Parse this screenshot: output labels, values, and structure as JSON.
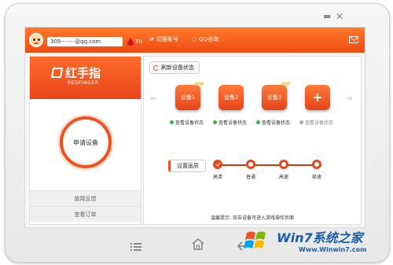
{
  "window": {
    "minimize_icon": "minimize-icon",
    "close_icon": "close-icon"
  },
  "topbar": {
    "account": "309········@qq.com",
    "points": "70",
    "switch_account": "切换账号",
    "qq_support": "QQ咨询"
  },
  "left": {
    "logo_text": "红手指",
    "logo_sub": "REDFINGER",
    "apply_button": "申请设备",
    "feedback": "故障反馈",
    "orders": "查看订单"
  },
  "right": {
    "refresh": "刷新设备状态",
    "devices": [
      {
        "label": "设备1",
        "vip": "VIP"
      },
      {
        "label": "设备2",
        "vip": ""
      },
      {
        "label": "设备3",
        "vip": "VIP"
      },
      {
        "label": "+",
        "vip": ""
      }
    ],
    "statuses": [
      {
        "label": "查看设备状态",
        "color": "#3fb24a"
      },
      {
        "label": "查看设备状态",
        "color": "#3fb24a"
      },
      {
        "label": "查看设备状态",
        "color": "#3fb24a"
      },
      {
        "label": "查看设备状态",
        "color": "#a9a9a9"
      }
    ],
    "quality_button": "设置画质",
    "quality_levels": [
      "高清",
      "普通",
      "高速",
      "极速"
    ],
    "quality_selected": "高清",
    "tip_prefix": "温馨提示:",
    "tip_text": "双击设备可进入游戏操作页面"
  },
  "watermark": {
    "text": "Win7系统之家",
    "url": "Www.Winwin7.com"
  },
  "colors": {
    "accent": "#ee4a12",
    "status_online": "#3fb24a",
    "status_offline": "#a9a9a9",
    "watermark": "#1a5ea8"
  }
}
